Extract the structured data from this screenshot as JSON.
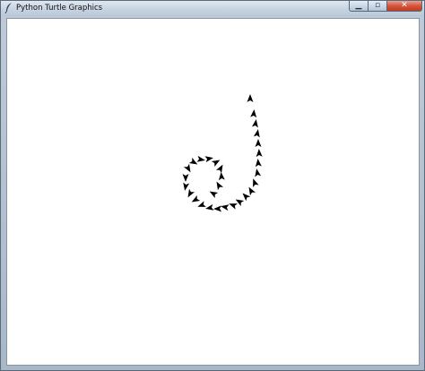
{
  "window": {
    "title": "Python Turtle Graphics",
    "app_icon": "feather-icon",
    "buttons": {
      "minimize": "minimize-icon",
      "maximize": "maximize-icon",
      "close": "close-icon"
    }
  },
  "colors": {
    "canvas_background": "#ffffff",
    "stamp_color": "#000000",
    "close_button": "#c94a30"
  },
  "stamp_shape": "arrow"
}
